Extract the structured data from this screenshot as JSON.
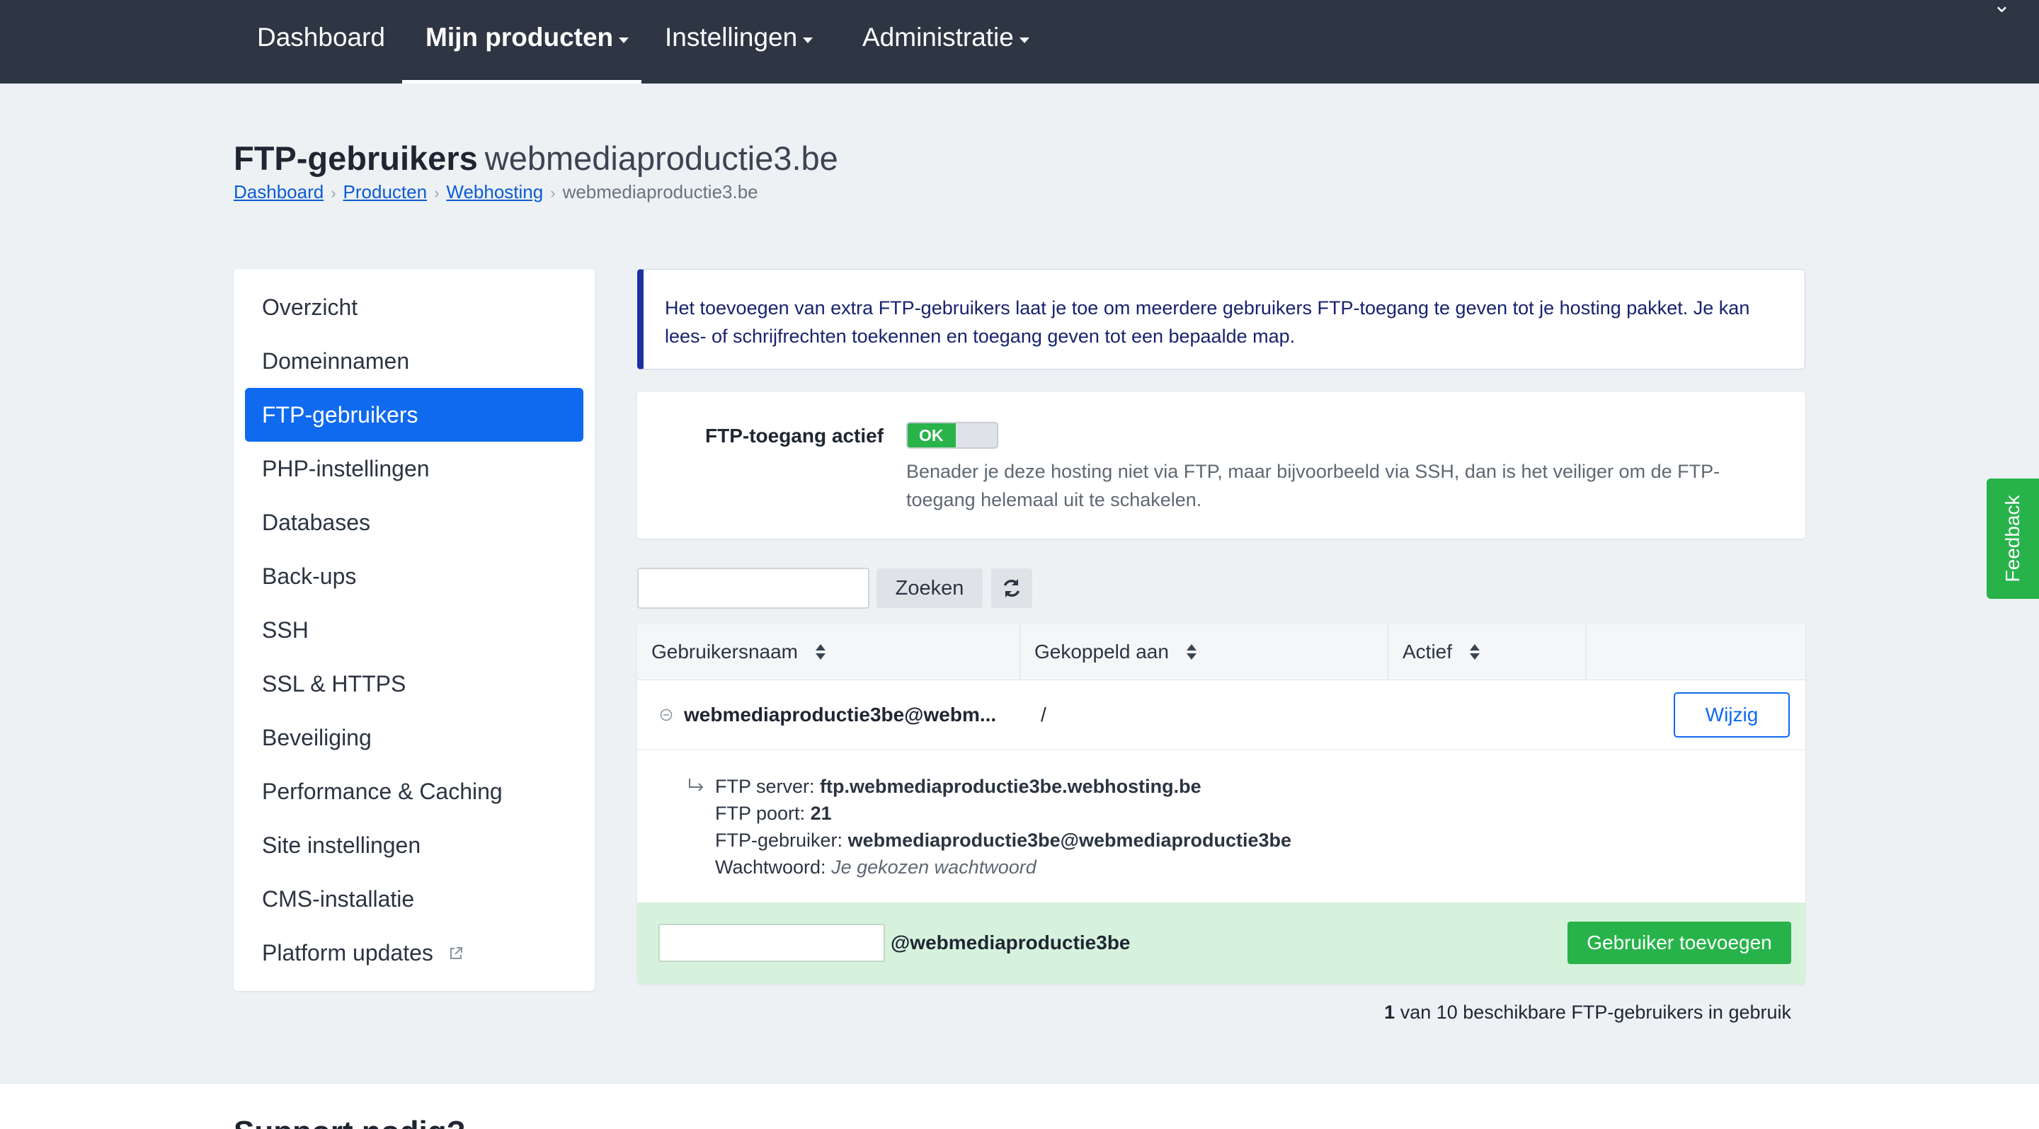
{
  "nav": {
    "items": [
      {
        "label": "Dashboard",
        "active": false,
        "has_caret": false
      },
      {
        "label": "Mijn producten",
        "active": true,
        "has_caret": true
      },
      {
        "label": "Instellingen",
        "active": false,
        "has_caret": true
      },
      {
        "label": "Administratie",
        "active": false,
        "has_caret": true
      }
    ]
  },
  "header": {
    "title": "FTP-gebruikers",
    "title_domain": "webmediaproductie3.be",
    "breadcrumb": [
      "Dashboard",
      "Producten",
      "Webhosting"
    ],
    "breadcrumb_current": "webmediaproductie3.be"
  },
  "sidebar": {
    "items": [
      {
        "label": "Overzicht"
      },
      {
        "label": "Domeinnamen"
      },
      {
        "label": "FTP-gebruikers",
        "active": true
      },
      {
        "label": "PHP-instellingen"
      },
      {
        "label": "Databases"
      },
      {
        "label": "Back-ups"
      },
      {
        "label": "SSH"
      },
      {
        "label": "SSL & HTTPS"
      },
      {
        "label": "Beveiliging"
      },
      {
        "label": "Performance & Caching"
      },
      {
        "label": "Site instellingen"
      },
      {
        "label": "CMS-installatie"
      },
      {
        "label": "Platform updates",
        "icon": "external-link-icon"
      }
    ]
  },
  "info": {
    "text": "Het toevoegen van extra FTP-gebruikers laat je toe om meerdere gebruikers FTP-toegang te geven tot je hosting pakket. Je kan lees- of schrijfrechten toekennen en toegang geven tot een bepaalde map."
  },
  "ftp_access": {
    "label": "FTP-toegang actief",
    "toggle_label": "OK",
    "enabled": true,
    "help": "Benader je deze hosting niet via FTP, maar bijvoorbeeld via SSH, dan is het veiliger om de FTP-toegang helemaal uit te schakelen."
  },
  "search": {
    "value": "",
    "button_label": "Zoeken",
    "refresh_icon": "refresh-icon"
  },
  "table": {
    "headers": [
      "Gebruikersnaam",
      "Gekoppeld aan",
      "Actief"
    ],
    "rows": [
      {
        "username": "webmediaproductie3be@webm...",
        "linked_to": "/",
        "edit_label": "Wijzig",
        "details": {
          "server_label": "FTP server:",
          "server_value": "ftp.webmediaproductie3be.webhosting.be",
          "port_label": "FTP poort:",
          "port_value": "21",
          "user_label": "FTP-gebruiker:",
          "user_value": "webmediaproductie3be@webmediaproductie3be",
          "password_label": "Wachtwoord:",
          "password_value": "Je gekozen wachtwoord"
        }
      }
    ]
  },
  "add_user": {
    "input_value": "",
    "suffix": "@webmediaproductie3be",
    "button_label": "Gebruiker toevoegen"
  },
  "usage": {
    "count": "1",
    "text": "van 10 beschikbare FTP-gebruikers in gebruik"
  },
  "footer": {
    "heading_partial": "Support nodig?"
  },
  "feedback": {
    "label": "Feedback"
  },
  "colors": {
    "nav_bg": "#2e3644",
    "accent_blue": "#0f6aef",
    "success_green": "#27b34a",
    "info_border": "#1d2fa3",
    "add_row_bg": "#d6f2dd"
  }
}
